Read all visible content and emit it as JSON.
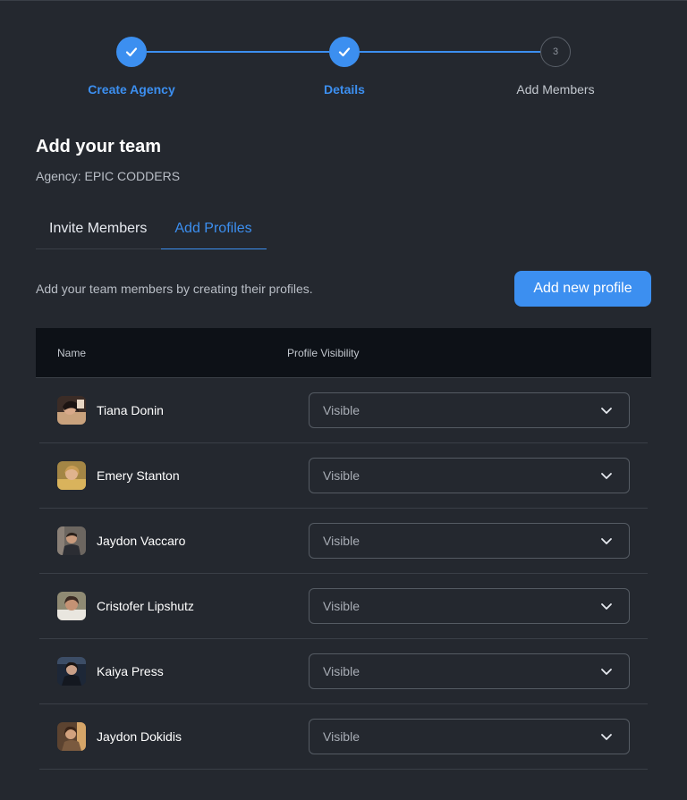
{
  "stepper": {
    "steps": [
      {
        "label": "Create Agency",
        "state": "done",
        "number": "1"
      },
      {
        "label": "Details",
        "state": "done",
        "number": "2"
      },
      {
        "label": "Add Members",
        "state": "pending",
        "number": "3"
      }
    ]
  },
  "header": {
    "title": "Add your team",
    "agency": "Agency: EPIC CODDERS"
  },
  "tabs": [
    {
      "label": "Invite Members",
      "active": false
    },
    {
      "label": "Add Profiles",
      "active": true
    }
  ],
  "main": {
    "description": "Add your team members by creating their profiles.",
    "add_button_label": "Add new profile"
  },
  "table": {
    "columns": [
      "Name",
      "Profile Visibility"
    ],
    "rows": [
      {
        "name": "Tiana Donin",
        "visibility": "Visible",
        "avatar": "avatar-photo"
      },
      {
        "name": "Emery Stanton",
        "visibility": "Visible",
        "avatar": "avatar-photo"
      },
      {
        "name": "Jaydon Vaccaro",
        "visibility": "Visible",
        "avatar": "avatar-photo"
      },
      {
        "name": "Cristofer Lipshutz",
        "visibility": "Visible",
        "avatar": "avatar-photo"
      },
      {
        "name": "Kaiya Press",
        "visibility": "Visible",
        "avatar": "avatar-photo"
      },
      {
        "name": "Jaydon Dokidis",
        "visibility": "Visible",
        "avatar": "avatar-photo"
      }
    ]
  },
  "colors": {
    "background": "#24282f",
    "accent": "#3c8ff0",
    "table_header": "#0d1117",
    "border": "#3a3f47"
  }
}
